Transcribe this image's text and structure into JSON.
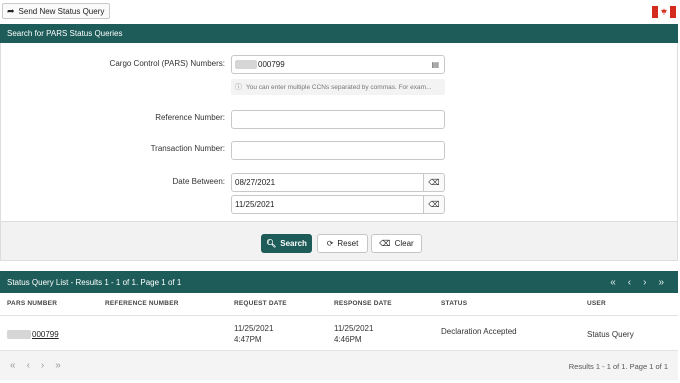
{
  "top": {
    "send_button_label": "Send New Status Query",
    "flag_icon": "canada-flag-icon"
  },
  "search": {
    "title": "Search for PARS Status Queries",
    "ccn_label": "Cargo Control (PARS) Numbers:",
    "ccn_value": "000799",
    "ccn_hint": "You can enter multiple CCNs separated by commas. For exam...",
    "reference_label": "Reference Number:",
    "reference_value": "",
    "transaction_label": "Transaction Number:",
    "transaction_value": "",
    "date_label": "Date Between:",
    "date_from": "08/27/2021",
    "date_to": "11/25/2021",
    "search_label": "Search",
    "reset_label": "Reset",
    "clear_label": "Clear"
  },
  "list": {
    "title": "Status Query List - Results 1 - 1 of 1. Page 1 of 1",
    "columns": [
      "PARS NUMBER",
      "REFERENCE NUMBER",
      "REQUEST DATE",
      "RESPONSE DATE",
      "STATUS",
      "USER"
    ],
    "rows": [
      {
        "pars_number": "000799",
        "reference_number": "",
        "request_date": "11/25/2021",
        "request_time": "4:47PM",
        "response_date": "11/25/2021",
        "response_time": "4:46PM",
        "status": "Declaration Accepted",
        "user": "Status Query"
      }
    ],
    "footer_text": "Results 1 - 1 of 1. Page 1 of 1",
    "pager": {
      "first": "«",
      "prev": "‹",
      "next": "›",
      "last": "»"
    }
  },
  "colors": {
    "header_green": "#1d5c59",
    "flag_red": "#d52b1e"
  }
}
